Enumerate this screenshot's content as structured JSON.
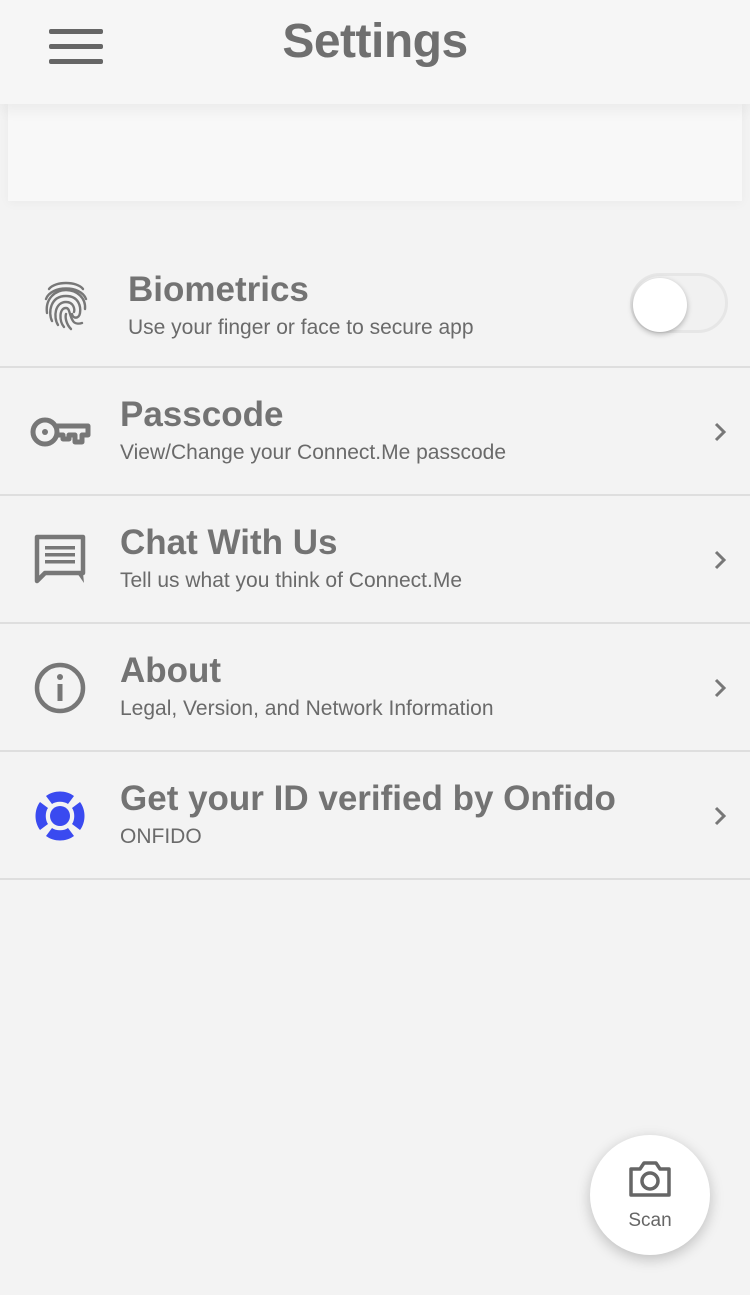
{
  "header": {
    "title": "Settings",
    "menu_icon": "hamburger-menu-icon"
  },
  "settings": {
    "biometrics": {
      "label": "Biometrics",
      "description": "Use your finger or face to secure app",
      "icon": "fingerprint-icon",
      "enabled": false
    },
    "passcode": {
      "label": "Passcode",
      "description": "View/Change your Connect.Me passcode",
      "icon": "key-icon"
    },
    "chat": {
      "label": "Chat With Us",
      "description": "Tell us what you think of Connect.Me",
      "icon": "chat-icon"
    },
    "about": {
      "label": "About",
      "description": "Legal, Version, and Network Information",
      "icon": "info-icon"
    },
    "onfido": {
      "label": "Get your ID verified by Onfido",
      "description": "ONFIDO",
      "icon": "onfido-logo-icon",
      "brand_color": "#3a4af0"
    }
  },
  "scan": {
    "label": "Scan",
    "icon": "camera-icon"
  },
  "colors": {
    "background": "#f3f3f3",
    "text": "#737373",
    "divider": "#dedede"
  }
}
